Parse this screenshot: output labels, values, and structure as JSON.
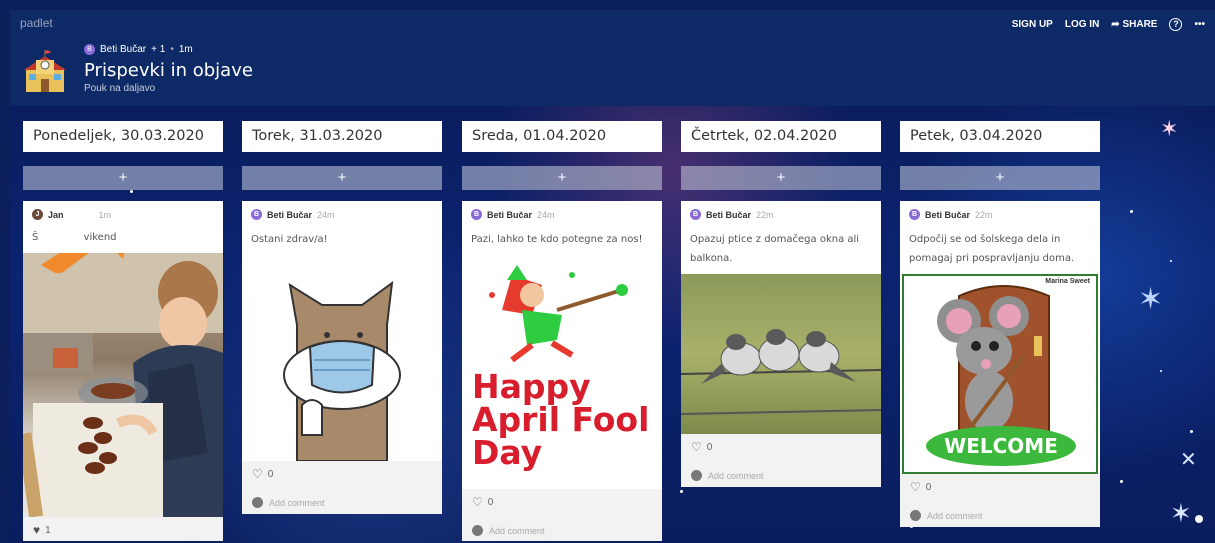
{
  "header": {
    "brand": "padlet",
    "actions": {
      "signup": "SIGN UP",
      "login": "LOG IN",
      "share": "SHARE",
      "help": "?",
      "more": "•••"
    },
    "share_arrow": "➦",
    "author": "Beti Bučar",
    "author_initial": "B",
    "plus": "+ 1",
    "dot": "•",
    "time": "1m",
    "title": "Prispevki in objave",
    "subtitle": "Pouk na daljavo"
  },
  "add_label": "+",
  "columns": [
    {
      "heading": "Ponedeljek, 30.03.2020",
      "post": {
        "author": "Jan",
        "initial": "J",
        "ago": "1m",
        "text": "Š",
        "text2": "vikend",
        "likes": "1"
      }
    },
    {
      "heading": "Torek, 31.03.2020",
      "post": {
        "author": "Beti Bučar",
        "initial": "B",
        "ago": "24m",
        "text": "Ostani zdrav/a!",
        "likes": "0",
        "comment": "Add comment"
      }
    },
    {
      "heading": "Sreda, 01.04.2020",
      "post": {
        "author": "Beti Bučar",
        "initial": "B",
        "ago": "24m",
        "text": "Pazi, lahko te kdo potegne za nos!",
        "image_text": [
          "Happy",
          "April Fool",
          "Day"
        ],
        "likes": "0",
        "comment": "Add comment"
      }
    },
    {
      "heading": "Četrtek, 02.04.2020",
      "post": {
        "author": "Beti Bučar",
        "initial": "B",
        "ago": "22m",
        "text": "Opazuj ptice z domačega okna ali balkona.",
        "likes": "0",
        "comment": "Add comment"
      }
    },
    {
      "heading": "Petek, 03.04.2020",
      "post": {
        "author": "Beti Bučar",
        "initial": "B",
        "ago": "22m",
        "text": "Odpočij se od šolskega dela in pomagaj pri pospravljanju doma.",
        "image_caption": "Marina Sweet",
        "image_text": "WELCOME",
        "likes": "0",
        "comment": "Add comment"
      }
    }
  ],
  "colors": {
    "header_bg": "#0e2a66",
    "accent_avatar": "#8a6ad6",
    "arrow": "#f08a2c",
    "april_red": "#d81e2c"
  }
}
